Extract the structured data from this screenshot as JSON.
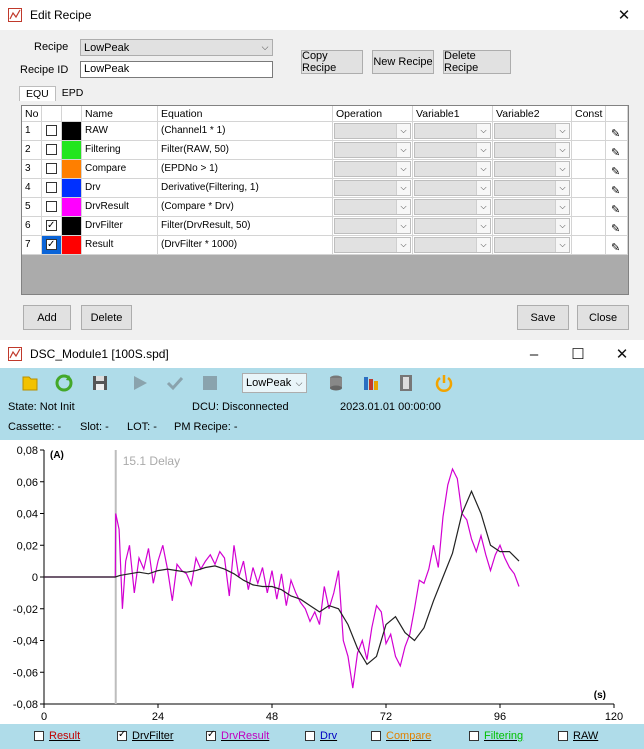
{
  "recipe_window": {
    "title": "Edit Recipe",
    "close_icon": "close-icon",
    "recipe_label": "Recipe",
    "recipe_value": "LowPeak",
    "recipe_id_label": "Recipe ID",
    "recipe_id_value": "LowPeak",
    "copy_label": "Copy Recipe",
    "new_label": "New Recipe",
    "delete_recipe_label": "Delete Recipe",
    "tabs": [
      "EQU",
      "EPD"
    ],
    "active_tab": "EQU",
    "columns": [
      "No",
      "",
      "Name",
      "Equation",
      "Operation",
      "Variable1",
      "Variable2",
      "Const"
    ],
    "rows": [
      {
        "no": "1",
        "checked": false,
        "color": "#000000",
        "name": "RAW",
        "equation": "(Channel1 * 1)"
      },
      {
        "no": "2",
        "checked": false,
        "color": "#22e61e",
        "name": "Filtering",
        "equation": "Filter(RAW, 50)"
      },
      {
        "no": "3",
        "checked": false,
        "color": "#ff7f00",
        "name": "Compare",
        "equation": "(EPDNo > 1)"
      },
      {
        "no": "4",
        "checked": false,
        "color": "#0030ff",
        "name": "Drv",
        "equation": "Derivative(Filtering, 1)"
      },
      {
        "no": "5",
        "checked": false,
        "color": "#ff00ff",
        "name": "DrvResult",
        "equation": "(Compare * Drv)"
      },
      {
        "no": "6",
        "checked": true,
        "color": "#000000",
        "name": "DrvFilter",
        "equation": "Filter(DrvResult, 50)"
      },
      {
        "no": "7",
        "checked": true,
        "color": "#ff0000",
        "name": "Result",
        "equation": "(DrvFilter * 1000)"
      }
    ],
    "add_label": "Add",
    "delete_label": "Delete",
    "save_label": "Save",
    "close_label": "Close"
  },
  "dsc_window": {
    "title": "DSC_Module1 [100S.spd]",
    "toolbar_recipe": "LowPeak",
    "status": {
      "state": "State: Not Init",
      "dcu": "DCU: Disconnected",
      "datetime": "2023.01.01 00:00:00",
      "cassette": "Cassette: -",
      "slot": "Slot: -",
      "lot": "LOT: -",
      "pm_recipe": "PM Recipe: -"
    },
    "legend": [
      {
        "name": "Result",
        "checked": false,
        "color": "#c00000"
      },
      {
        "name": "DrvFilter",
        "checked": true,
        "color": "#000000"
      },
      {
        "name": "DrvResult",
        "checked": true,
        "color": "#c000c0"
      },
      {
        "name": "Drv",
        "checked": false,
        "color": "#0000c0"
      },
      {
        "name": "Compare",
        "checked": false,
        "color": "#e08000"
      },
      {
        "name": "Filtering",
        "checked": false,
        "color": "#00c000"
      },
      {
        "name": "RAW",
        "checked": false,
        "color": "#000000"
      }
    ]
  },
  "chart_data": {
    "type": "line",
    "ylabel": "(A)",
    "xlabel": "(s)",
    "xlim": [
      0,
      120
    ],
    "ylim": [
      -0.08,
      0.08
    ],
    "x_ticks": [
      "0",
      "24",
      "48",
      "72",
      "96",
      "120"
    ],
    "y_ticks": [
      "0,08",
      "0,06",
      "0,04",
      "0,02",
      "0",
      "-0,02",
      "-0,04",
      "-0,06",
      "-0,08"
    ],
    "annotation": "15.1 Delay",
    "delay_x": 15.1,
    "series": [
      {
        "name": "DrvResult",
        "color": "#d200d2",
        "x": [
          0,
          15,
          15.1,
          15.8,
          16.5,
          17.2,
          18,
          19,
          20,
          21,
          22,
          23,
          24,
          25,
          26,
          27,
          28,
          29,
          30,
          31,
          32,
          33,
          34,
          35,
          36,
          37,
          38,
          39,
          40,
          41,
          42,
          43,
          44,
          45,
          46,
          47,
          48,
          49,
          50,
          51,
          52,
          53,
          54,
          55,
          56,
          57,
          58,
          59,
          60,
          61,
          62,
          63,
          64,
          65,
          66,
          67,
          68,
          69,
          70,
          71,
          72,
          73,
          74,
          75,
          76,
          77,
          78,
          79,
          80,
          81,
          82,
          83,
          84,
          85,
          86,
          87,
          88,
          89,
          90,
          91,
          92,
          93,
          94,
          95,
          96,
          97,
          98,
          99,
          100
        ],
        "y": [
          0,
          0,
          0.04,
          0.03,
          -0.02,
          0.01,
          0.02,
          -0.01,
          0.012,
          0.005,
          0.018,
          -0.004,
          0.01,
          0.02,
          0.005,
          -0.015,
          0.008,
          0.004,
          0.002,
          -0.005,
          0.012,
          0.005,
          0.01,
          0.014,
          0.008,
          0.016,
          0.012,
          -0.012,
          0.02,
          0.0,
          0.01,
          -0.008,
          0.006,
          -0.004,
          0.006,
          -0.01,
          0.004,
          -0.014,
          0.002,
          -0.018,
          -0.002,
          -0.01,
          -0.016,
          -0.02,
          -0.028,
          -0.022,
          -0.03,
          -0.006,
          -0.02,
          -0.01,
          0.004,
          -0.04,
          -0.05,
          -0.07,
          -0.048,
          -0.04,
          -0.052,
          -0.032,
          -0.018,
          -0.022,
          -0.042,
          -0.036,
          -0.05,
          -0.056,
          -0.044,
          -0.036,
          -0.02,
          -0.002,
          -0.004,
          0.005,
          0.02,
          0.006,
          0.038,
          0.058,
          0.068,
          0.062,
          0.04,
          0.036,
          0.024,
          0.016,
          0.026,
          0.014,
          0.004,
          0.014,
          0.02,
          0.012,
          0.006,
          0.002,
          -0.006
        ]
      },
      {
        "name": "DrvFilter",
        "color": "#222222",
        "x": [
          0,
          15,
          16,
          18,
          20,
          22,
          24,
          26,
          28,
          30,
          32,
          34,
          36,
          38,
          40,
          42,
          44,
          46,
          48,
          50,
          52,
          54,
          56,
          58,
          60,
          62,
          64,
          66,
          68,
          70,
          72,
          74,
          76,
          78,
          80,
          82,
          84,
          86,
          88,
          90,
          92,
          94,
          96,
          98,
          100
        ],
        "y": [
          0,
          0,
          0.001,
          0.002,
          0.003,
          0.002,
          0.004,
          0.005,
          0.004,
          0.003,
          0.004,
          0.006,
          0.007,
          0.005,
          0.002,
          -0.002,
          -0.005,
          -0.006,
          -0.006,
          -0.008,
          -0.012,
          -0.014,
          -0.018,
          -0.022,
          -0.018,
          -0.02,
          -0.03,
          -0.045,
          -0.055,
          -0.05,
          -0.03,
          -0.025,
          -0.035,
          -0.04,
          -0.032,
          -0.015,
          0.0,
          0.015,
          0.04,
          0.054,
          0.04,
          0.02,
          0.016,
          0.016,
          0.01
        ]
      }
    ]
  }
}
